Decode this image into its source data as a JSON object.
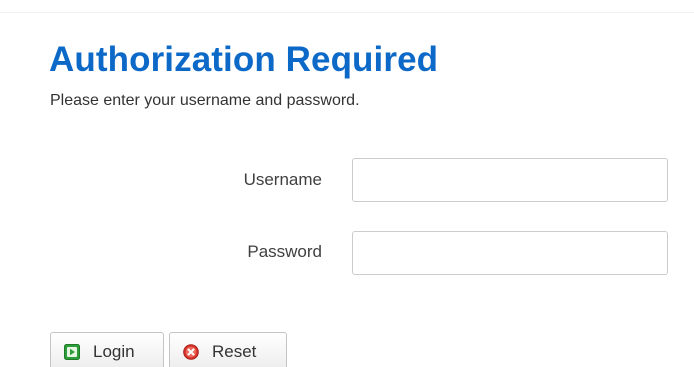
{
  "header": {
    "title": "Authorization Required",
    "subtitle": "Please enter your username and password."
  },
  "form": {
    "username": {
      "label": "Username",
      "value": "",
      "placeholder": ""
    },
    "password": {
      "label": "Password",
      "value": "",
      "placeholder": ""
    }
  },
  "actions": {
    "login_label": "Login",
    "login_icon": "login-icon",
    "reset_label": "Reset",
    "reset_icon": "reset-icon"
  },
  "colors": {
    "title": "#0d69c7",
    "login_icon": "#2e9e3a",
    "reset_icon": "#d9342b"
  }
}
